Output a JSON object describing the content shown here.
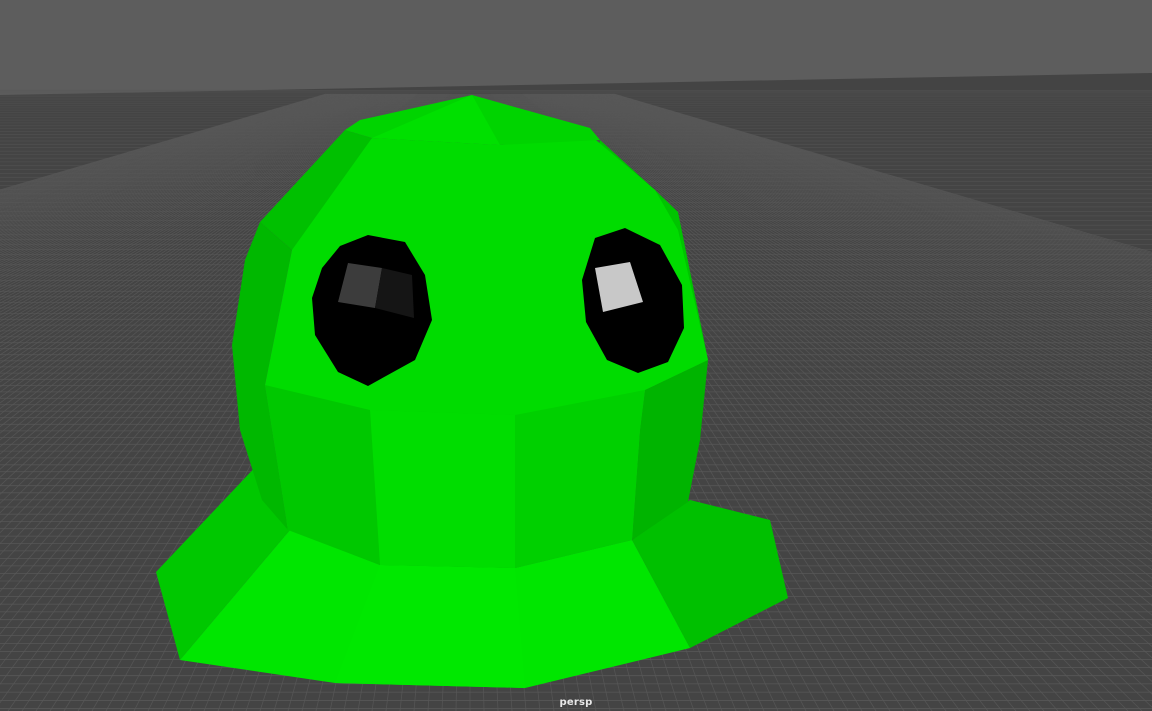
{
  "viewport": {
    "camera_label": "persp",
    "background_color": "#5d5d5d",
    "ground_color": "#444444",
    "grid_line_color": "#595959"
  },
  "model": {
    "name": "slime",
    "body_color": "#00e000",
    "shade_color": "#00b400",
    "eye_color": "#000000",
    "eye_highlight_color": "#c8c8c8"
  }
}
